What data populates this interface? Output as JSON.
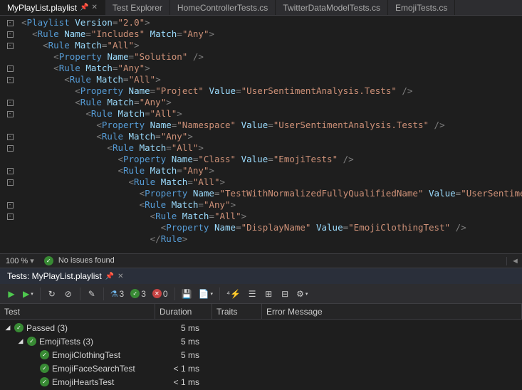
{
  "tabs": [
    {
      "label": "MyPlayList.playlist",
      "active": true,
      "pinned": true
    },
    {
      "label": "Test Explorer"
    },
    {
      "label": "HomeControllerTests.cs"
    },
    {
      "label": "TwitterDataModelTests.cs"
    },
    {
      "label": "EmojiTests.cs"
    }
  ],
  "editor": {
    "lines": [
      {
        "ind": 0,
        "g": "-",
        "t": "tag-open",
        "tag": "Playlist",
        "attrs": [
          [
            "Version",
            "2.0"
          ]
        ]
      },
      {
        "ind": 1,
        "g": "-",
        "t": "tag-open",
        "tag": "Rule",
        "attrs": [
          [
            "Name",
            "Includes"
          ],
          [
            "Match",
            "Any"
          ]
        ]
      },
      {
        "ind": 2,
        "g": "-",
        "t": "tag-open",
        "tag": "Rule",
        "attrs": [
          [
            "Match",
            "All"
          ]
        ]
      },
      {
        "ind": 3,
        "g": "",
        "t": "tag-self",
        "tag": "Property",
        "attrs": [
          [
            "Name",
            "Solution"
          ]
        ]
      },
      {
        "ind": 3,
        "g": "-",
        "t": "tag-open",
        "tag": "Rule",
        "attrs": [
          [
            "Match",
            "Any"
          ]
        ]
      },
      {
        "ind": 4,
        "g": "-",
        "t": "tag-open",
        "tag": "Rule",
        "attrs": [
          [
            "Match",
            "All"
          ]
        ]
      },
      {
        "ind": 5,
        "g": "",
        "t": "tag-self",
        "tag": "Property",
        "attrs": [
          [
            "Name",
            "Project"
          ],
          [
            "Value",
            "UserSentimentAnalysis.Tests"
          ]
        ]
      },
      {
        "ind": 5,
        "g": "-",
        "t": "tag-open",
        "tag": "Rule",
        "attrs": [
          [
            "Match",
            "Any"
          ]
        ]
      },
      {
        "ind": 6,
        "g": "-",
        "t": "tag-open",
        "tag": "Rule",
        "attrs": [
          [
            "Match",
            "All"
          ]
        ]
      },
      {
        "ind": 7,
        "g": "",
        "t": "tag-self",
        "tag": "Property",
        "attrs": [
          [
            "Name",
            "Namespace"
          ],
          [
            "Value",
            "UserSentimentAnalysis.Tests"
          ]
        ]
      },
      {
        "ind": 7,
        "g": "-",
        "t": "tag-open",
        "tag": "Rule",
        "attrs": [
          [
            "Match",
            "Any"
          ]
        ]
      },
      {
        "ind": 8,
        "g": "-",
        "t": "tag-open",
        "tag": "Rule",
        "attrs": [
          [
            "Match",
            "All"
          ]
        ]
      },
      {
        "ind": 9,
        "g": "",
        "t": "tag-self",
        "tag": "Property",
        "attrs": [
          [
            "Name",
            "Class"
          ],
          [
            "Value",
            "EmojiTests"
          ]
        ]
      },
      {
        "ind": 9,
        "g": "-",
        "t": "tag-open",
        "tag": "Rule",
        "attrs": [
          [
            "Match",
            "Any"
          ]
        ]
      },
      {
        "ind": 10,
        "g": "-",
        "t": "tag-open",
        "tag": "Rule",
        "attrs": [
          [
            "Match",
            "All"
          ]
        ]
      },
      {
        "ind": 11,
        "g": "",
        "t": "tag-self",
        "tag": "Property",
        "attrs": [
          [
            "Name",
            "TestWithNormalizedFullyQualifiedName"
          ],
          [
            "Value",
            "UserSentimentA"
          ]
        ]
      },
      {
        "ind": 11,
        "g": "-",
        "t": "tag-open",
        "tag": "Rule",
        "attrs": [
          [
            "Match",
            "Any"
          ]
        ]
      },
      {
        "ind": 12,
        "g": "-",
        "t": "tag-open",
        "tag": "Rule",
        "attrs": [
          [
            "Match",
            "All"
          ]
        ]
      },
      {
        "ind": 13,
        "g": "",
        "t": "tag-self",
        "tag": "Property",
        "attrs": [
          [
            "Name",
            "DisplayName"
          ],
          [
            "Value",
            "EmojiClothingTest"
          ]
        ]
      },
      {
        "ind": 12,
        "g": "",
        "t": "tag-close",
        "tag": "Rule"
      }
    ]
  },
  "editorStatus": {
    "zoom": "100 %",
    "issues": "No issues found"
  },
  "testPanel": {
    "title": "Tests: MyPlayList.playlist",
    "counts": {
      "flask": "3",
      "pass": "3",
      "fail": "0"
    },
    "columns": [
      "Test",
      "Duration",
      "Traits",
      "Error Message"
    ],
    "rows": [
      {
        "depth": 0,
        "chev": "▢",
        "icon": "pass",
        "label": "Passed (3)",
        "dur": "5 ms"
      },
      {
        "depth": 1,
        "chev": "▢",
        "icon": "pass",
        "label": "EmojiTests (3)",
        "dur": "5 ms"
      },
      {
        "depth": 2,
        "chev": "",
        "icon": "pass",
        "label": "EmojiClothingTest",
        "dur": "5 ms"
      },
      {
        "depth": 2,
        "chev": "",
        "icon": "pass",
        "label": "EmojiFaceSearchTest",
        "dur": "< 1 ms"
      },
      {
        "depth": 2,
        "chev": "",
        "icon": "pass",
        "label": "EmojiHeartsTest",
        "dur": "< 1 ms"
      }
    ]
  }
}
